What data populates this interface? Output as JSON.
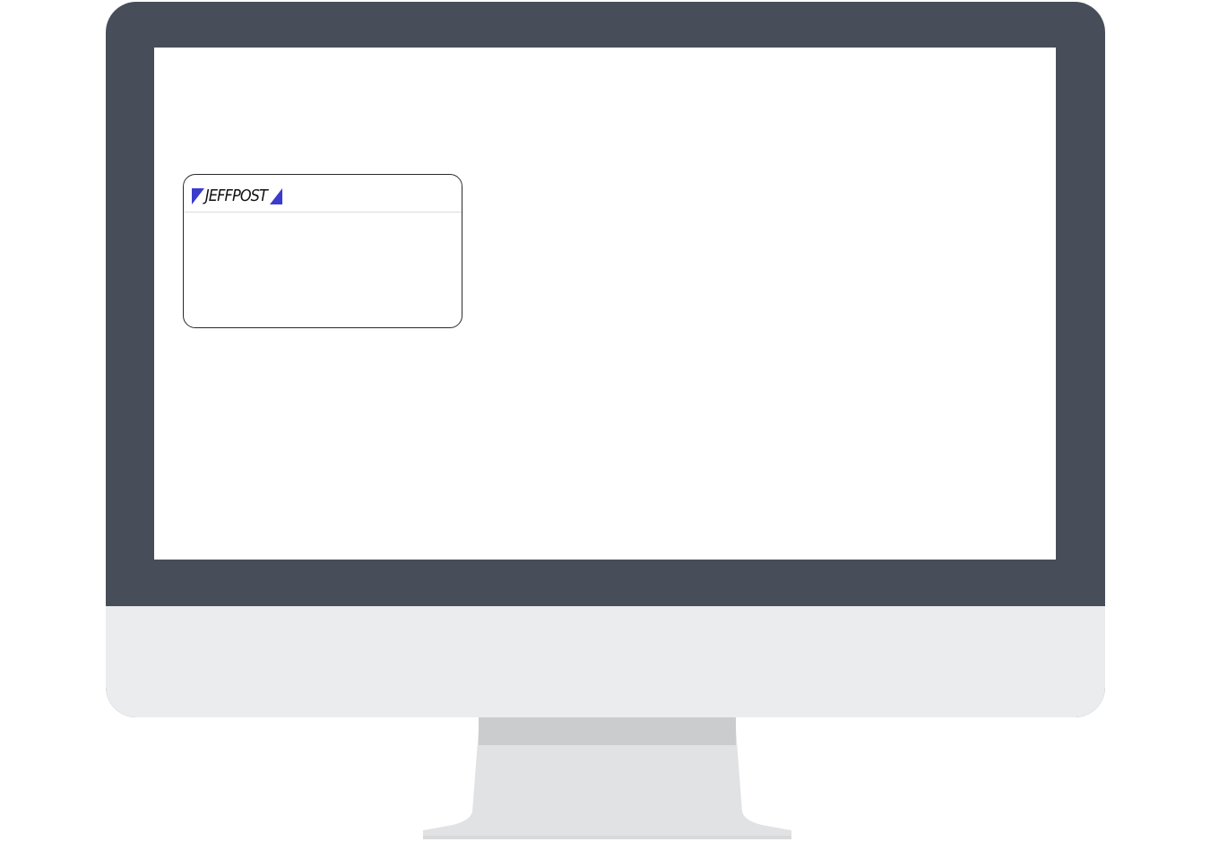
{
  "logo": {
    "text": "JEFFPOST",
    "accent_color": "#3b3bcc"
  },
  "colors": {
    "bezel": "#474e5a",
    "chin": "#ebecee",
    "stand": "#e1e2e4",
    "stand_shadow": "#cbccce",
    "screen": "#ffffff"
  }
}
